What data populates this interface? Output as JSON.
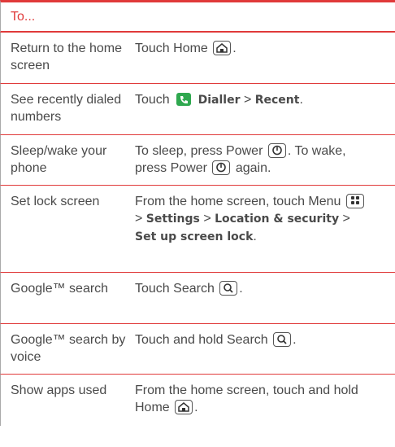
{
  "header": "To...",
  "rows": [
    {
      "col1": "Return to the home screen",
      "col2": {
        "a": "Touch Home",
        "b": "."
      }
    },
    {
      "col1": "See recently dialed numbers",
      "col2": {
        "a": "Touch",
        "app": "Dialler",
        "sep": ">",
        "recent": "Recent",
        "end": "."
      }
    },
    {
      "col1": "Sleep/wake your phone",
      "col2": {
        "a": "To sleep, press Power",
        "b": ". To wake, press Power",
        "c": "again."
      }
    },
    {
      "col1": "Set lock screen",
      "col2": {
        "a": "From the home screen, touch Menu",
        "gt1": ">",
        "settings": "Settings",
        "gt2": ">",
        "loc": "Location & security",
        "gt3": ">",
        "lock": "Set up screen lock",
        "end": "."
      }
    },
    {
      "col1": "Google™ search",
      "col2": {
        "a": "Touch Search",
        "b": "."
      }
    },
    {
      "col1": "Google™ search by voice",
      "col2": {
        "a": "Touch and hold Search",
        "b": "."
      }
    },
    {
      "col1": "Show apps used",
      "col2": {
        "a": "From the home screen, touch and hold Home",
        "b": "."
      }
    }
  ],
  "icons": {
    "home": "home-key-icon",
    "power": "power-key-icon",
    "menu": "menu-key-icon",
    "search": "search-key-icon",
    "dialer": "dialer-app-icon"
  },
  "colors": {
    "accent": "#e03a3a",
    "text": "#4a4a4a",
    "dialer_green": "#2fa84f"
  }
}
